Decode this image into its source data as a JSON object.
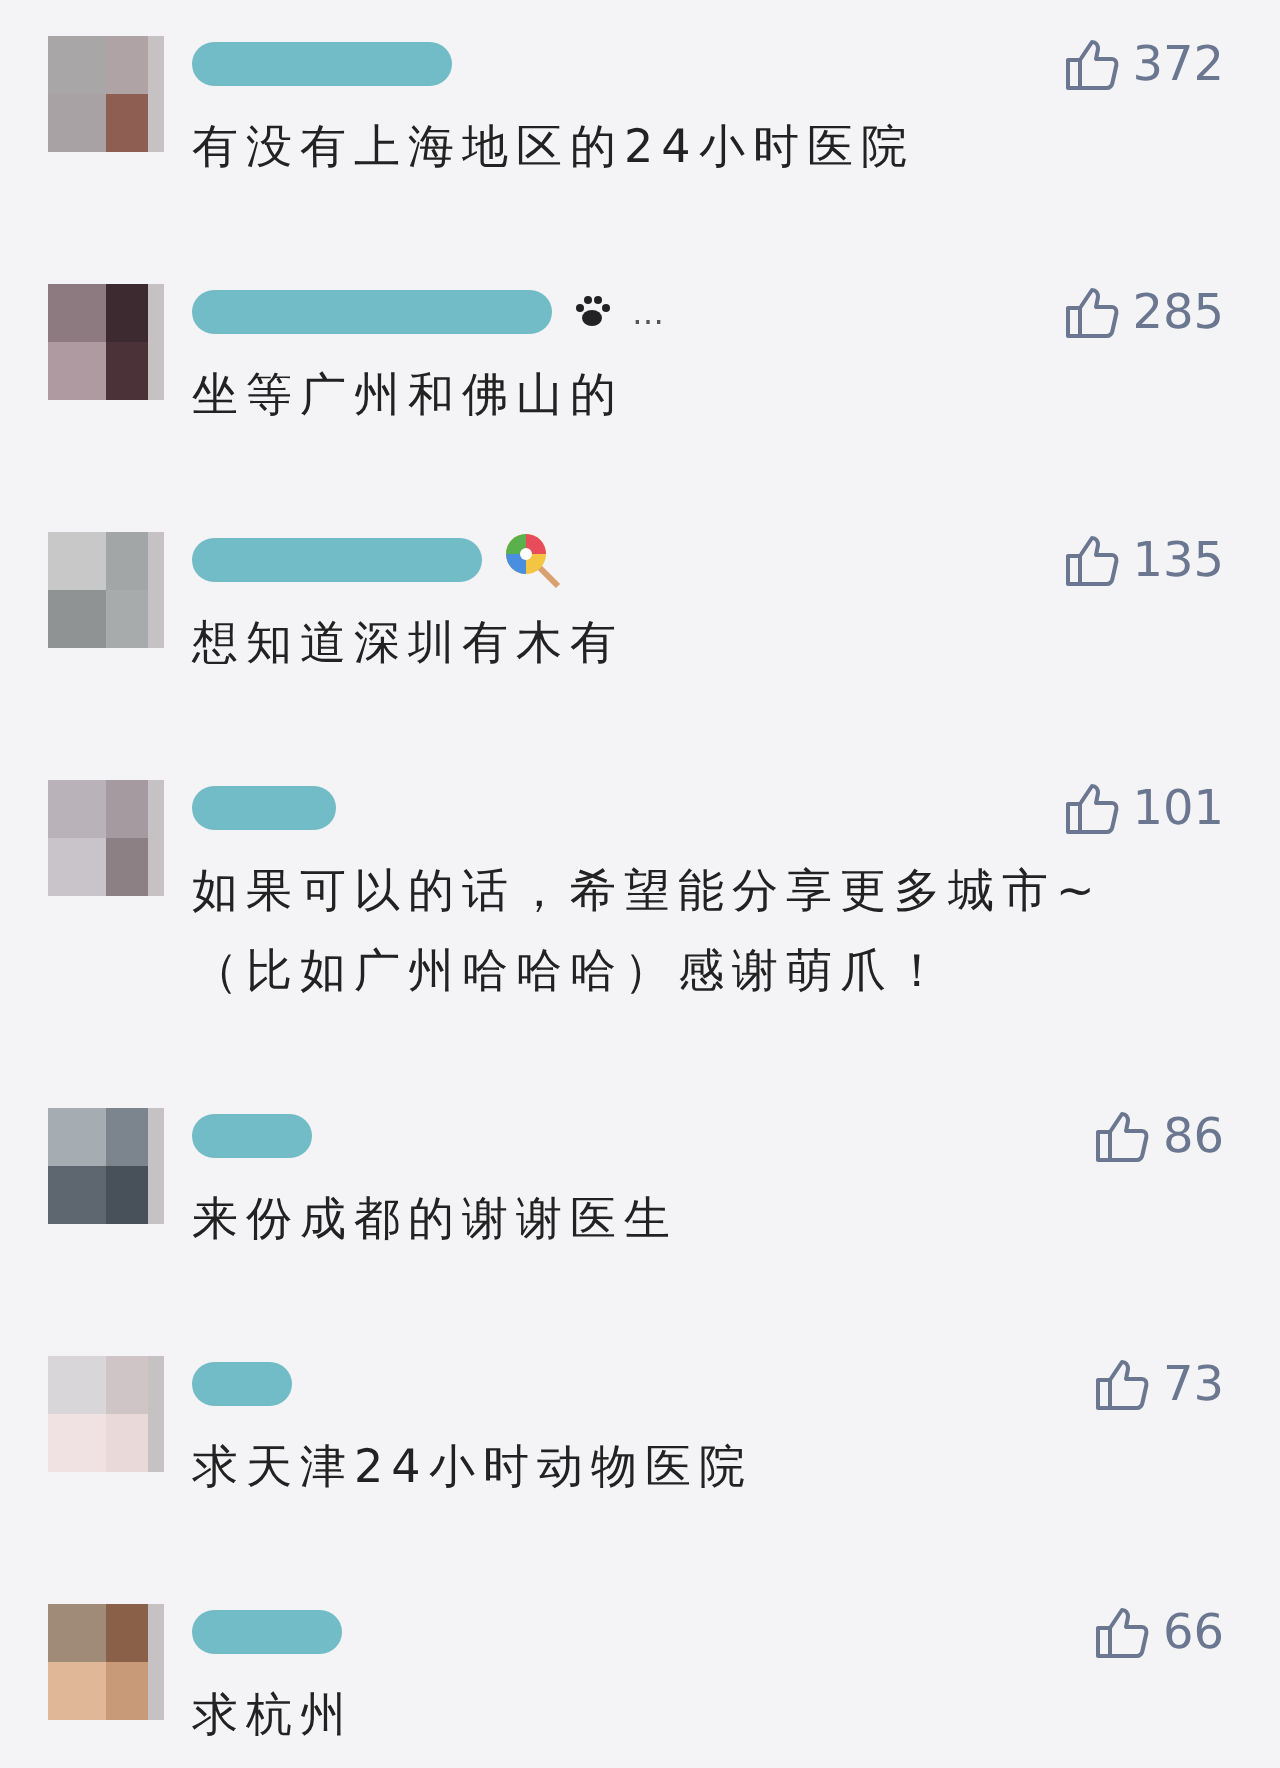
{
  "comments": [
    {
      "kind": "plain",
      "likes": "372",
      "text": "有没有上海地区的24小时医院"
    },
    {
      "kind": "paw",
      "likes": "285",
      "text": "坐等广州和佛山的",
      "name_suffix": "…"
    },
    {
      "kind": "lollipop",
      "likes": "135",
      "text": "想知道深圳有木有"
    },
    {
      "kind": "plain",
      "likes": "101",
      "text": "如果可以的话，希望能分享更多城市~（比如广州哈哈哈）感谢萌爪！"
    },
    {
      "kind": "plain",
      "likes": "86",
      "text": "来份成都的谢谢医生"
    },
    {
      "kind": "plain",
      "likes": "73",
      "text": "求天津24小时动物医院"
    },
    {
      "kind": "plain",
      "likes": "66",
      "text": "求杭州"
    }
  ]
}
